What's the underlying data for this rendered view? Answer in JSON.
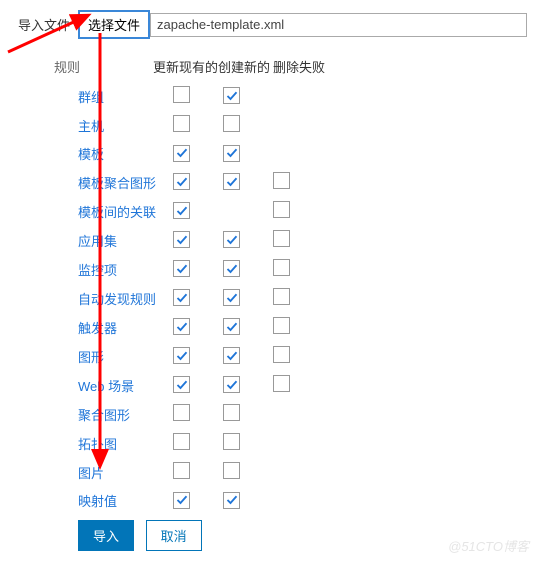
{
  "file_row": {
    "label": "导入文件",
    "button_label": "选择文件",
    "filename": "zapache-template.xml"
  },
  "rules": {
    "section_label": "规则",
    "headers": {
      "update": "更新现有的",
      "create": "创建新的",
      "delete": "删除失败"
    },
    "items": [
      {
        "name": "群组",
        "c1": false,
        "c2": true,
        "c3": null
      },
      {
        "name": "主机",
        "c1": false,
        "c2": false,
        "c3": null
      },
      {
        "name": "模板",
        "c1": true,
        "c2": true,
        "c3": null
      },
      {
        "name": "模板聚合图形",
        "c1": true,
        "c2": true,
        "c3": false
      },
      {
        "name": "模板间的关联",
        "c1": true,
        "c2": null,
        "c3": false
      },
      {
        "name": "应用集",
        "c1": true,
        "c2": true,
        "c3": false
      },
      {
        "name": "监控项",
        "c1": true,
        "c2": true,
        "c3": false
      },
      {
        "name": "自动发现规则",
        "c1": true,
        "c2": true,
        "c3": false
      },
      {
        "name": "触发器",
        "c1": true,
        "c2": true,
        "c3": false
      },
      {
        "name": "图形",
        "c1": true,
        "c2": true,
        "c3": false
      },
      {
        "name": "Web 场景",
        "c1": true,
        "c2": true,
        "c3": false
      },
      {
        "name": "聚合图形",
        "c1": false,
        "c2": false,
        "c3": null
      },
      {
        "name": "拓扑图",
        "c1": false,
        "c2": false,
        "c3": null
      },
      {
        "name": "图片",
        "c1": false,
        "c2": false,
        "c3": null
      },
      {
        "name": "映射值",
        "c1": true,
        "c2": true,
        "c3": null
      }
    ]
  },
  "buttons": {
    "import": "导入",
    "cancel": "取消"
  },
  "watermark": "@51CTO博客",
  "colors": {
    "link": "#1f75d8",
    "primary": "#0275b8",
    "arrow": "#ff0000"
  }
}
